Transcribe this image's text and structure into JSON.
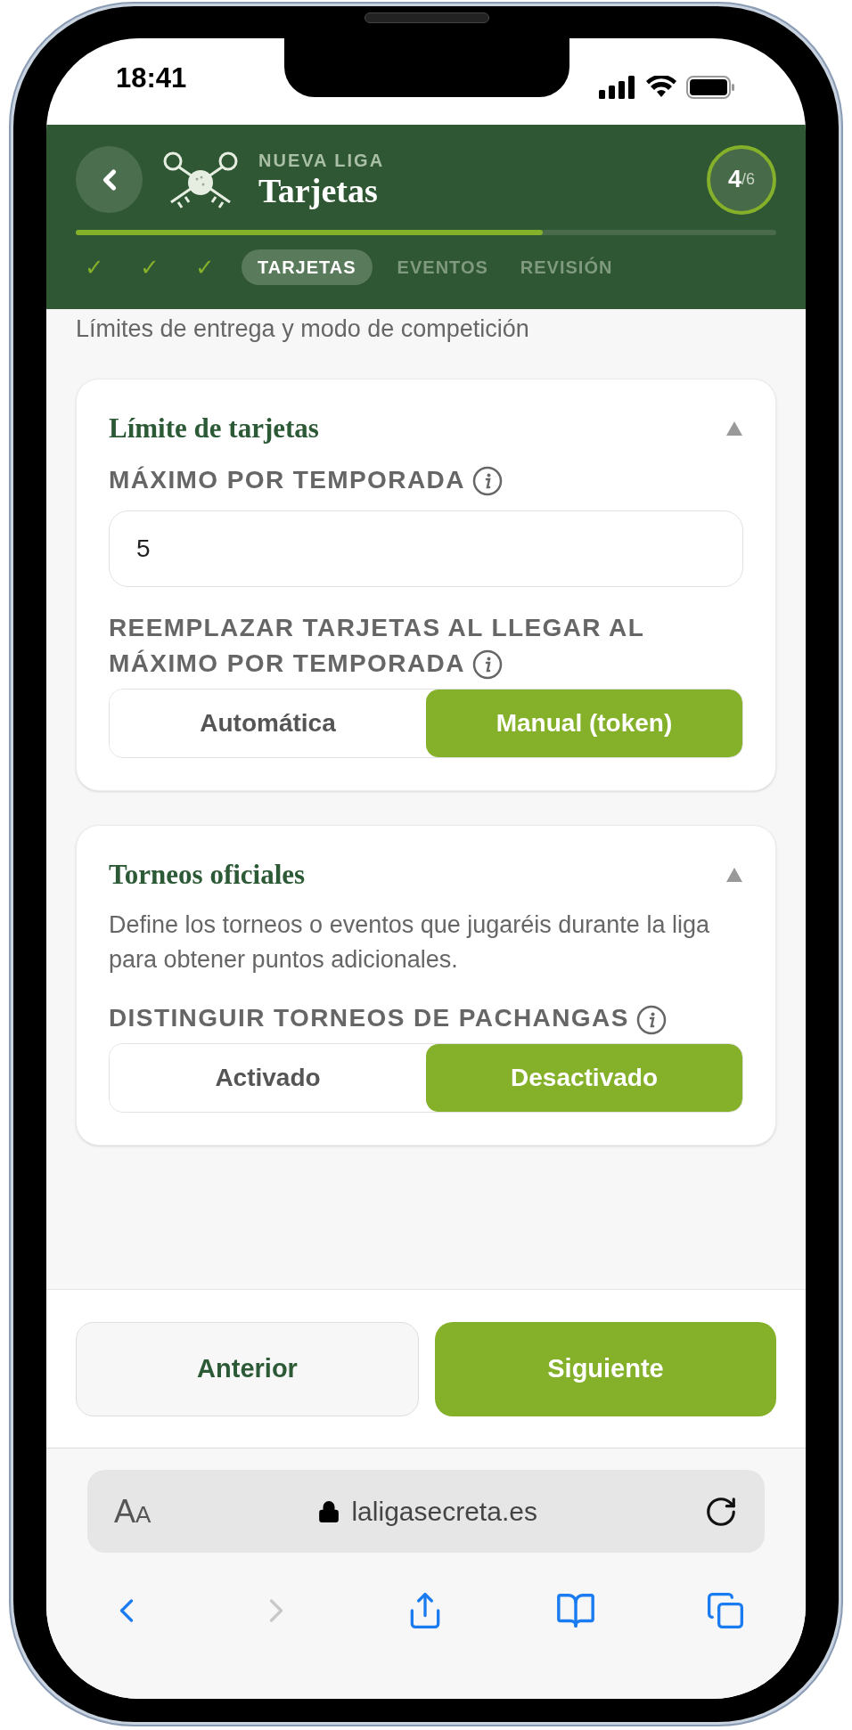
{
  "status_bar": {
    "time": "18:41"
  },
  "header": {
    "overline": "NUEVA LIGA",
    "title": "Tarjetas",
    "step_current": "4",
    "step_total": "/6",
    "progress": {
      "level": 0.667
    }
  },
  "steps": [
    {
      "kind": "done",
      "label": "✓",
      "selected": false
    },
    {
      "kind": "done",
      "label": "✓",
      "selected": false
    },
    {
      "kind": "done",
      "label": "✓",
      "selected": false
    },
    {
      "kind": "step",
      "label": "TARJETAS",
      "selected": true
    },
    {
      "kind": "step",
      "label": "EVENTOS",
      "selected": false
    },
    {
      "kind": "step",
      "label": "REVISIÓN",
      "selected": false
    }
  ],
  "subtitle": "Límites de entrega y modo de competición",
  "sections": [
    {
      "title": "Límite de tarjetas",
      "expanded": true,
      "fields": [
        {
          "kind": "number",
          "label": "MÁXIMO POR TEMPORADA",
          "value": "5"
        },
        {
          "kind": "segmented",
          "label": "REEMPLAZAR TARJETAS AL LLEGAR AL MÁXIMO POR TEMPORADA",
          "options": [
            {
              "label": "Automática",
              "selected": false
            },
            {
              "label": "Manual (token)",
              "selected": true
            }
          ]
        }
      ]
    },
    {
      "title": "Torneos oficiales",
      "expanded": true,
      "description": "Define los torneos o eventos que jugaréis durante la liga para obtener puntos adicionales.",
      "fields": [
        {
          "kind": "segmented",
          "label": "DISTINGUIR TORNEOS DE PACHANGAS",
          "options": [
            {
              "label": "Activado",
              "selected": false
            },
            {
              "label": "Desactivado",
              "selected": true
            }
          ]
        }
      ]
    }
  ],
  "footer_buttons": [
    {
      "kind": "secondary",
      "label": "Anterior"
    },
    {
      "kind": "primary",
      "label": "Siguiente"
    }
  ],
  "browser": {
    "text_size": "AA",
    "url": "laligasecreta.es"
  },
  "toolbar": [
    {
      "kind": "back",
      "disabled": false
    },
    {
      "kind": "forward",
      "disabled": true
    },
    {
      "kind": "share",
      "disabled": false
    },
    {
      "kind": "bookmarks",
      "disabled": false
    },
    {
      "kind": "tabs",
      "disabled": false
    }
  ]
}
